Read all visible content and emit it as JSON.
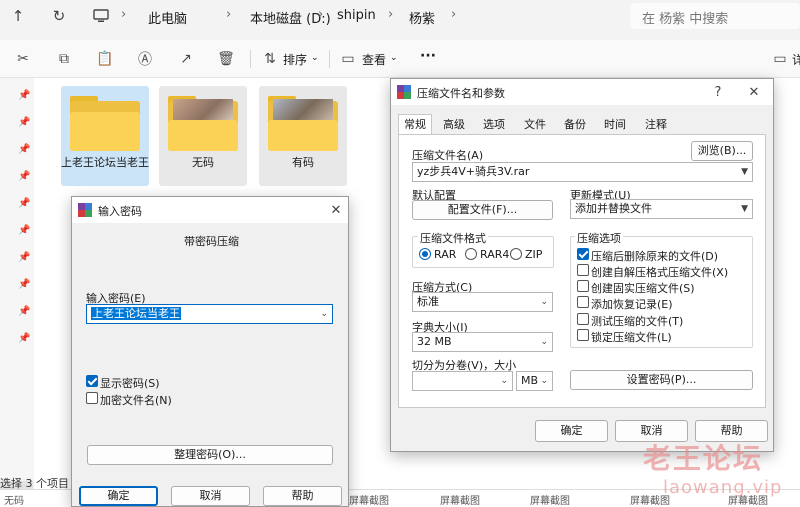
{
  "explorer": {
    "breadcrumb": [
      "此电脑",
      "本地磁盘 (D:)",
      "shipin",
      "杨紫"
    ],
    "search_placeholder": "在 杨紫 中搜索",
    "toolbar": {
      "sort_label": "排序",
      "view_label": "查看",
      "more_label": "···",
      "details_label": "详"
    },
    "folders": [
      {
        "name": "上老王论坛当老王",
        "state": "selected"
      },
      {
        "name": "无码",
        "state": "hover"
      },
      {
        "name": "有码",
        "state": "hover"
      }
    ],
    "status_text": "选择 3 个项目",
    "strip": [
      "无码",
      "屏幕截图",
      "屏幕截图",
      "屏幕截图",
      "屏幕截图",
      "屏幕截图"
    ]
  },
  "password_dialog": {
    "title": "输入密码",
    "heading": "带密码压缩",
    "password_label": "输入密码(E)",
    "password_value": "上老王论坛当老王",
    "show_password_label": "显示密码(S)",
    "show_password_checked": true,
    "encrypt_names_label": "加密文件名(N)",
    "encrypt_names_checked": false,
    "organize_button": "整理密码(O)...",
    "ok_button": "确定",
    "cancel_button": "取消",
    "help_button": "帮助"
  },
  "archive_dialog": {
    "title": "压缩文件名和参数",
    "help_glyph": "?",
    "tabs": [
      "常规",
      "高级",
      "选项",
      "文件",
      "备份",
      "时间",
      "注释"
    ],
    "active_tab": "常规",
    "archive_name_label": "压缩文件名(A)",
    "browse_button": "浏览(B)...",
    "archive_name_value": "yz步兵4V+骑兵3V.rar",
    "default_profile_label": "默认配置",
    "profiles_button": "配置文件(F)...",
    "update_mode_label": "更新模式(U)",
    "update_mode_value": "添加并替换文件",
    "format_group_label": "压缩文件格式",
    "formats": [
      {
        "label": "RAR",
        "selected": true
      },
      {
        "label": "RAR4",
        "selected": false
      },
      {
        "label": "ZIP",
        "selected": false
      }
    ],
    "options_group_label": "压缩选项",
    "options": [
      {
        "label": "压缩后删除原来的文件(D)",
        "checked": true
      },
      {
        "label": "创建自解压格式压缩文件(X)",
        "checked": false
      },
      {
        "label": "创建固实压缩文件(S)",
        "checked": false
      },
      {
        "label": "添加恢复记录(E)",
        "checked": false
      },
      {
        "label": "测试压缩的文件(T)",
        "checked": false
      },
      {
        "label": "锁定压缩文件(L)",
        "checked": false
      }
    ],
    "method_label": "压缩方式(C)",
    "method_value": "标准",
    "dict_label": "字典大小(I)",
    "dict_value": "32 MB",
    "split_label": "切分为分卷(V)，大小",
    "split_value": "",
    "split_unit": "MB",
    "set_password_button": "设置密码(P)...",
    "ok_button": "确定",
    "cancel_button": "取消",
    "help_button": "帮助"
  },
  "watermark": {
    "main": "老王论坛",
    "sub": "laowang.vip"
  }
}
